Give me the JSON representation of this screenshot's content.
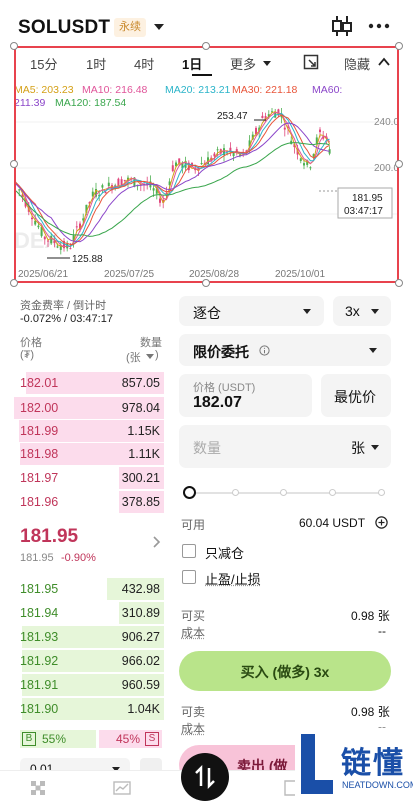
{
  "header": {
    "symbol": "SOLUSDT",
    "badge": "永续"
  },
  "chart_toolbar": {
    "tabs": [
      "15分",
      "1时",
      "4时",
      "1日",
      "更多"
    ],
    "hide_label": "隐藏"
  },
  "ma_legend": {
    "ma5": "MA5: 203.23",
    "ma10": "MA10: 216.48",
    "ma20": "MA20: 213.21",
    "ma30": "MA30: 221.18",
    "ma60": "MA60:",
    "ma60_value": "211.39",
    "ma120": "MA120: 187.54",
    "colors": {
      "ma5": "#d4a017",
      "ma10": "#e0559a",
      "ma20": "#2bb4c9",
      "ma30": "#e8553a",
      "ma60": "#8b46c9",
      "ma120": "#3aa64d"
    }
  },
  "chart": {
    "y_ticks": [
      "240.00",
      "200.00"
    ],
    "x_ticks": [
      "2025/06/21",
      "2025/07/25",
      "2025/08/28",
      "2025/10/01"
    ],
    "high_label": "253.47",
    "low_label": "125.88",
    "price_tag": "181.95",
    "countdown": "03:47:17",
    "watermark": "DEX"
  },
  "funding": {
    "label": "资金费率 / 倒计时",
    "value": "-0.072% / 03:47:17"
  },
  "orderbook": {
    "price_header": "价格",
    "price_unit": "(₮)",
    "qty_header": "数量",
    "qty_unit": "(张",
    "asks": [
      {
        "price": "182.01",
        "qty": "857.05",
        "fill": 0.92
      },
      {
        "price": "182.00",
        "qty": "978.04",
        "fill": 1.0
      },
      {
        "price": "181.99",
        "qty": "1.15K",
        "fill": 0.97
      },
      {
        "price": "181.98",
        "qty": "1.11K",
        "fill": 0.96
      },
      {
        "price": "181.97",
        "qty": "300.21",
        "fill": 0.3
      },
      {
        "price": "181.96",
        "qty": "378.85",
        "fill": 0.3
      }
    ],
    "last_price": "181.95",
    "mark_price": "181.95",
    "change": "-0.90%",
    "bids": [
      {
        "price": "181.95",
        "qty": "432.98",
        "fill": 0.38
      },
      {
        "price": "181.94",
        "qty": "310.89",
        "fill": 0.3
      },
      {
        "price": "181.93",
        "qty": "906.27",
        "fill": 0.95
      },
      {
        "price": "181.92",
        "qty": "966.02",
        "fill": 0.95
      },
      {
        "price": "181.91",
        "qty": "960.59",
        "fill": 0.95
      },
      {
        "price": "181.90",
        "qty": "1.04K",
        "fill": 0.95
      }
    ],
    "buy_tag": "B",
    "buy_ratio": "55%",
    "sell_ratio": "45%",
    "sell_tag": "S",
    "depth_value": "0.01"
  },
  "order_form": {
    "margin_mode": "逐仓",
    "leverage": "3x",
    "order_type": "限价委托",
    "price_label": "价格 (USDT)",
    "price_value": "182.07",
    "best_price": "最优价",
    "qty_placeholder": "数量",
    "qty_unit": "张",
    "available_label": "可用",
    "available_value": "60.04 USDT",
    "reduce_only": "只减仓",
    "tp_sl": "止盈/止损",
    "can_buy_label": "可买",
    "can_buy_value": "0.98 张",
    "cost_label": "成本",
    "cost_value": "--",
    "buy_button": "买入 (做多) 3x",
    "can_sell_label": "可卖",
    "can_sell_value": "0.98 张",
    "cost2_label": "成本",
    "cost2_value": "--",
    "sell_button": "卖出 (做"
  },
  "watermark_logo": {
    "brand": "链懂",
    "site": "NEATDOWN.COM"
  }
}
